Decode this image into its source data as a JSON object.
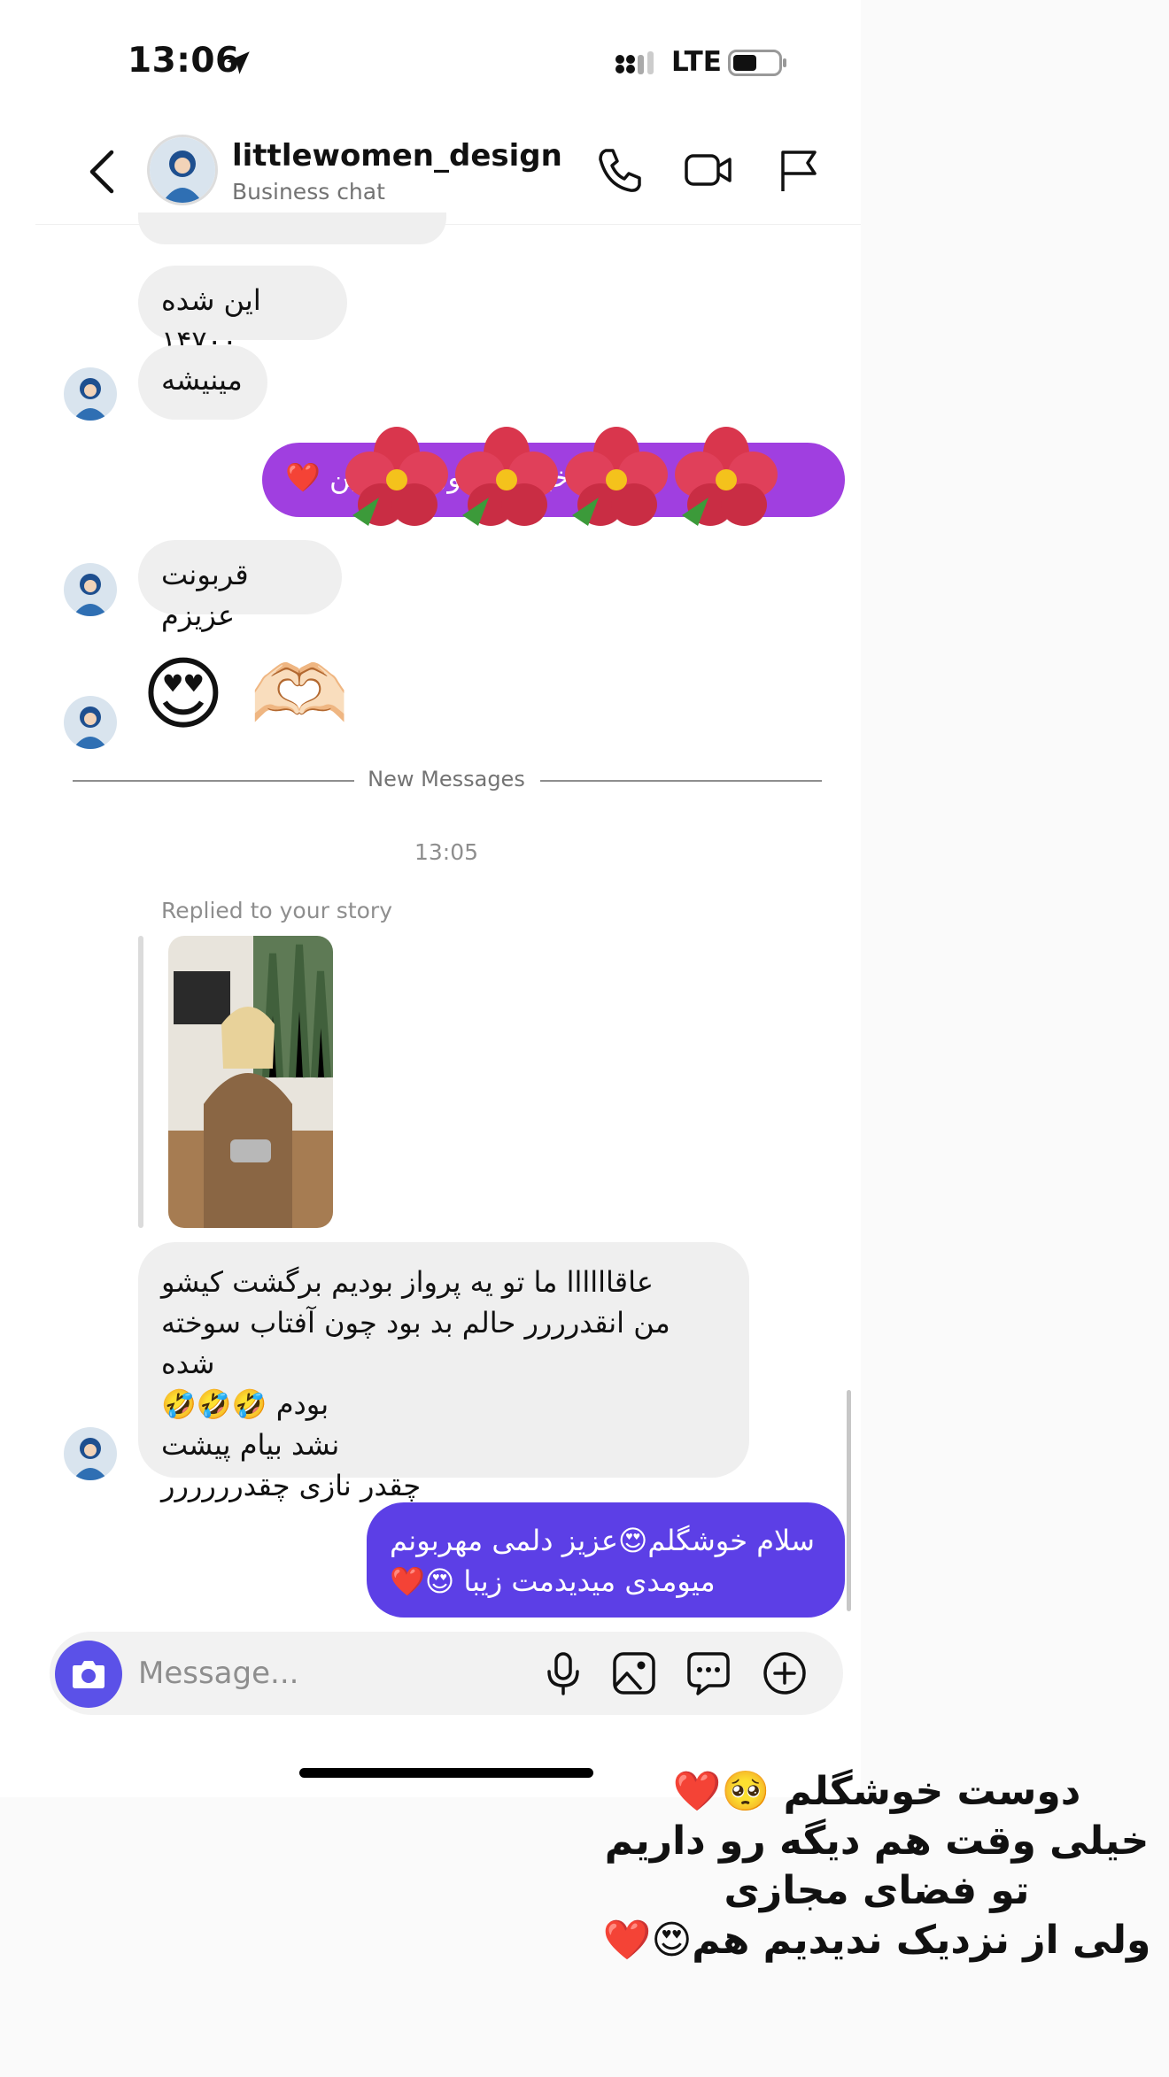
{
  "status": {
    "time": "13:06",
    "network": "LTE"
  },
  "header": {
    "name": "littlewomen_design",
    "subtitle": "Business chat",
    "icons": [
      "back-chevron-icon",
      "phone-icon",
      "video-icon",
      "flag-icon"
    ]
  },
  "messages": {
    "m1": "این شده ۱۴۷۰۰",
    "m2": "مینیشه",
    "m3": "عزیزم خیلی ممنون همچنین ❤️",
    "m4": "قربونت عزیزم",
    "m5": "😍 🫶🏻",
    "new_messages": "New Messages",
    "timestamp": "13:05",
    "replied": "Replied to your story",
    "m6": [
      "عاقاااااا ما تو یه پرواز بودیم برگشت کیشو",
      "من انقدرررر حالم بد بود چون آفتاب سوخته شده",
      "بودم 🤣🤣🤣",
      "نشد بیام پیشت",
      "چقدر نازی چقدرررررر"
    ],
    "m7": [
      "سلام خوشگلم😍عزیز دلمی مهربونم",
      "میومدی میدیدمت زیبا 😍❤️"
    ]
  },
  "composer": {
    "placeholder": "Message...",
    "icons": [
      "camera-icon",
      "mic-icon",
      "gallery-icon",
      "sticker-icon",
      "plus-icon"
    ]
  },
  "caption": [
    "دوست خوشگلم 🥺❤️",
    "خیلی وقت هم دیگه رو داریم",
    "تو فضای مجازی",
    "ولی از نزدیک ندیدیم هم😍❤️"
  ],
  "colors": {
    "outgoing_bubble": "#5c3fe6",
    "purple_bubble": "#a03fe0",
    "incoming_bubble": "#efefef",
    "camera_button": "#5b51e8"
  }
}
